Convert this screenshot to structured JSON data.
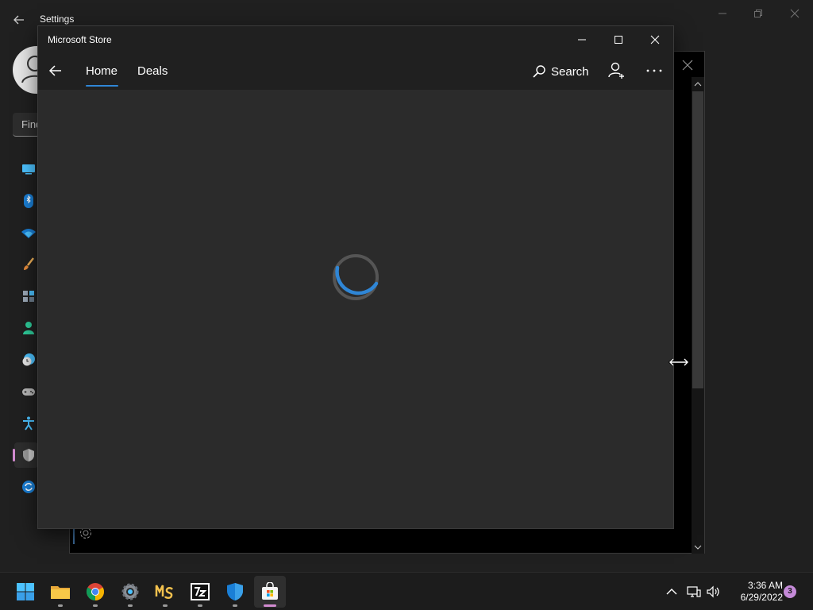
{
  "settings": {
    "title": "Settings",
    "search_placeholder": "Find",
    "nav_icons": [
      "monitor-icon",
      "bluetooth-icon",
      "wifi-icon",
      "brush-icon",
      "apps-icon",
      "person-icon",
      "clock-globe-icon",
      "gamepad-icon",
      "accessibility-icon",
      "shield-icon",
      "update-icon"
    ],
    "active_item": "shield-icon",
    "accent": "#d28bd0"
  },
  "store": {
    "title": "Microsoft Store",
    "tabs": [
      {
        "label": "Home",
        "selected": true
      },
      {
        "label": "Deals",
        "selected": false
      }
    ],
    "search_label": "Search",
    "status": "loading",
    "accent": "#2f86d6"
  },
  "taskbar": {
    "apps": [
      "start-icon",
      "file-explorer-icon",
      "chrome-icon",
      "settings-icon",
      "ms-app-icon",
      "7zip-icon",
      "windows-security-icon",
      "microsoft-store-icon"
    ],
    "active_app": "microsoft-store-icon",
    "time": "3:36 AM",
    "date": "6/29/2022",
    "notification_count": "3"
  }
}
